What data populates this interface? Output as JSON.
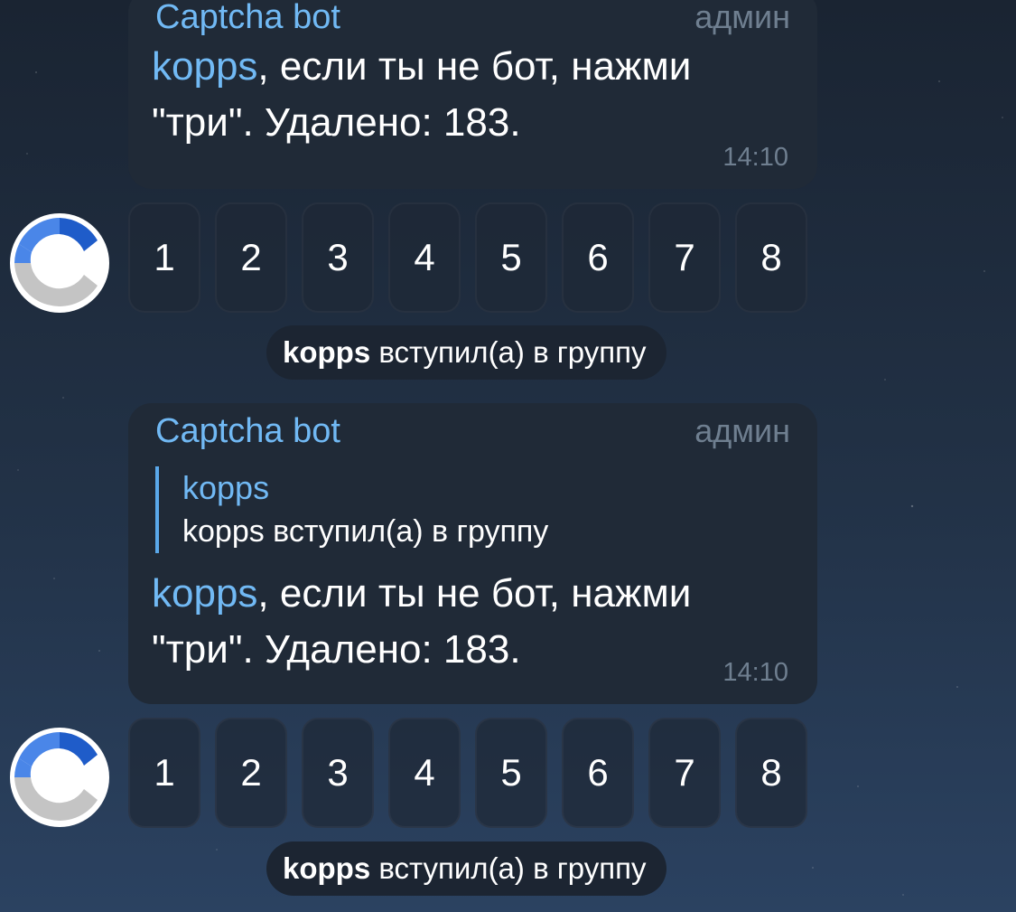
{
  "messages": [
    {
      "sender": "Captcha bot",
      "role": "админ",
      "mention": "kopps",
      "text_after_mention": ", если ты не бот, нажми",
      "text_line2": "\"три\". Удалено: 183.",
      "time": "14:10"
    },
    {
      "sender": "Captcha bot",
      "role": "админ",
      "reply": {
        "name": "kopps",
        "text": "kopps вступил(а) в группу"
      },
      "mention": "kopps",
      "text_after_mention": ", если ты не бот, нажми",
      "text_line2": "\"три\". Удалено: 183.",
      "time": "14:10"
    }
  ],
  "keyboards": [
    {
      "buttons": [
        "1",
        "2",
        "3",
        "4",
        "5",
        "6",
        "7",
        "8"
      ]
    },
    {
      "buttons": [
        "1",
        "2",
        "3",
        "4",
        "5",
        "6",
        "7",
        "8"
      ]
    }
  ],
  "service_messages": [
    {
      "user": "kopps",
      "action": "вступил(а) в группу"
    },
    {
      "user": "kopps",
      "action": "вступил(а) в группу"
    }
  ],
  "avatar": {
    "icon": "captcha-bot-avatar-icon"
  },
  "colors": {
    "accent": "#71b9f4",
    "bubble": "#202a37",
    "muted": "#6f7f90"
  }
}
